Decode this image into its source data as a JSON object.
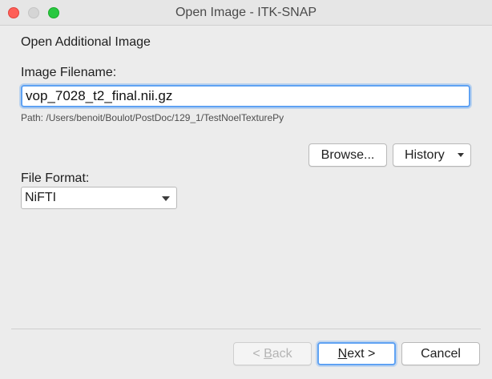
{
  "window": {
    "title": "Open Image - ITK-SNAP"
  },
  "heading": "Open Additional Image",
  "filename": {
    "label": "Image Filename:",
    "value": "vop_7028_t2_final.nii.gz"
  },
  "path_text": "Path: /Users/benoit/Boulot/PostDoc/129_1/TestNoelTexturePy",
  "buttons": {
    "browse": "Browse...",
    "history": "History",
    "back_prefix": "< ",
    "back_mnemonic": "B",
    "back_rest": "ack",
    "next_mnemonic": "N",
    "next_rest": "ext >",
    "cancel": "Cancel"
  },
  "file_format": {
    "label": "File Format:",
    "selected": "NiFTI"
  },
  "colors": {
    "focus_ring": "#5fa2f3",
    "close": "#fe5f57",
    "minimize_inactive": "#d5d5d5",
    "maximize": "#28c840"
  }
}
